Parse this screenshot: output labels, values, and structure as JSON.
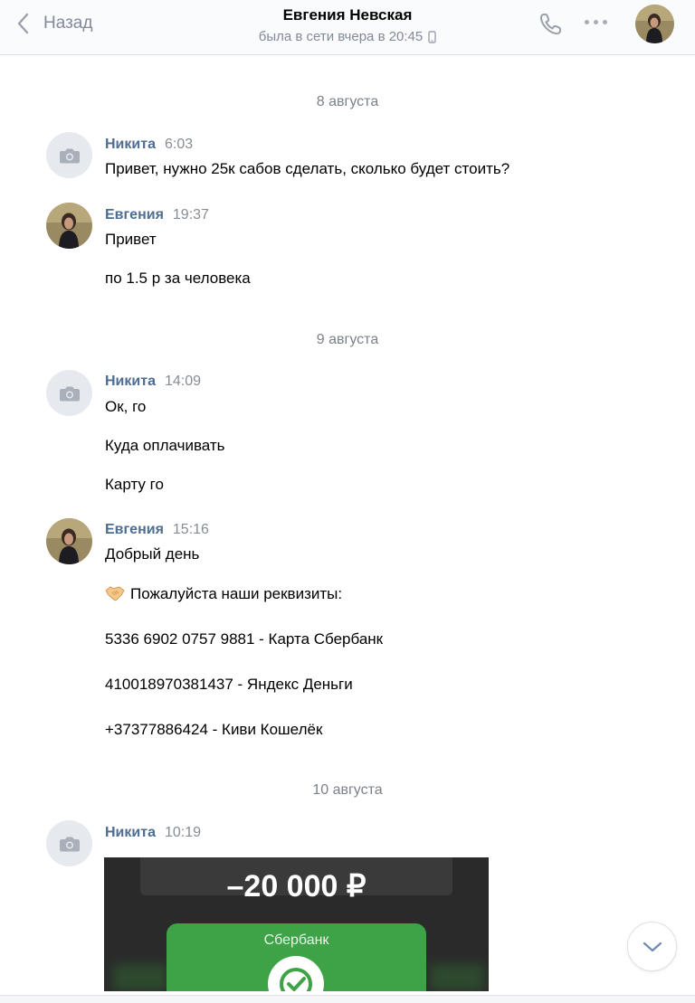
{
  "header": {
    "back_label": "Назад",
    "title": "Евгения Невская",
    "status": "была в сети вчера в 20:45"
  },
  "icons": {
    "back": "chevron-left-icon",
    "phone": "phone-icon",
    "more": "more-horizontal-icon",
    "mobile": "mobile-device-icon",
    "camera": "camera-icon",
    "scroll_down": "chevron-down-icon",
    "handshake": "handshake-emoji"
  },
  "colors": {
    "author": "#4d6d93",
    "muted": "#828a99",
    "sber_green": "#3ea346"
  },
  "dates": [
    "8 августа",
    "9 августа",
    "10 августа"
  ],
  "messages": [
    {
      "author": "Никита",
      "time": "6:03",
      "lines": [
        "Привет, нужно 25к сабов сделать, сколько будет стоить?"
      ]
    },
    {
      "author": "Евгения",
      "time": "19:37",
      "lines": [
        "Привет",
        "по 1.5 р за человека"
      ]
    },
    {
      "author": "Никита",
      "time": "14:09",
      "lines": [
        "Ок, го",
        "Куда оплачивать",
        "Карту го"
      ]
    },
    {
      "author": "Евгения",
      "time": "15:16",
      "lines": [
        "Добрый день",
        "Пожалуйста наши реквизиты:",
        "5336 6902 0757 9881 - Карта Сбербанк",
        "410018970381437 - Яндекс Деньги",
        "+37377886424 - Киви Кошелёк"
      ]
    },
    {
      "author": "Никита",
      "time": "10:19",
      "lines": []
    }
  ],
  "receipt": {
    "amount": "–20 000 ₽",
    "bank": "Сбербанк"
  }
}
